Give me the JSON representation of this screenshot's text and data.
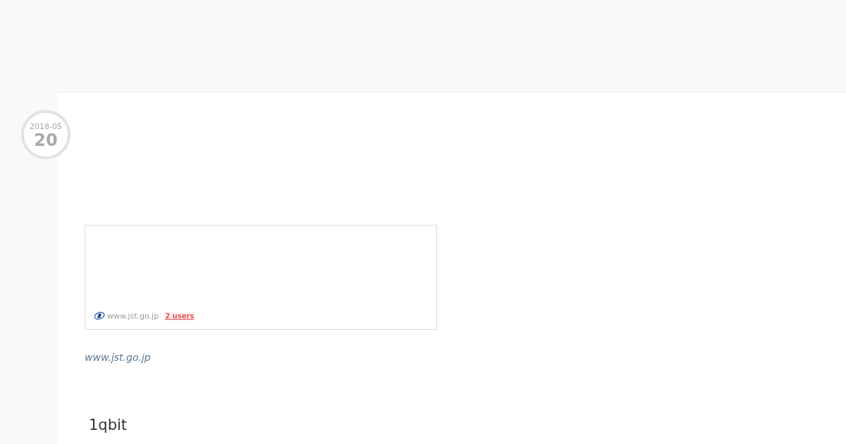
{
  "entry": {
    "date": {
      "year_month": "2018-05",
      "day": "20"
    },
    "embed": {
      "site": "www.jst.go.jp",
      "users": "2 users"
    },
    "link": "www.jst.go.jp",
    "heading": "1qbit"
  }
}
